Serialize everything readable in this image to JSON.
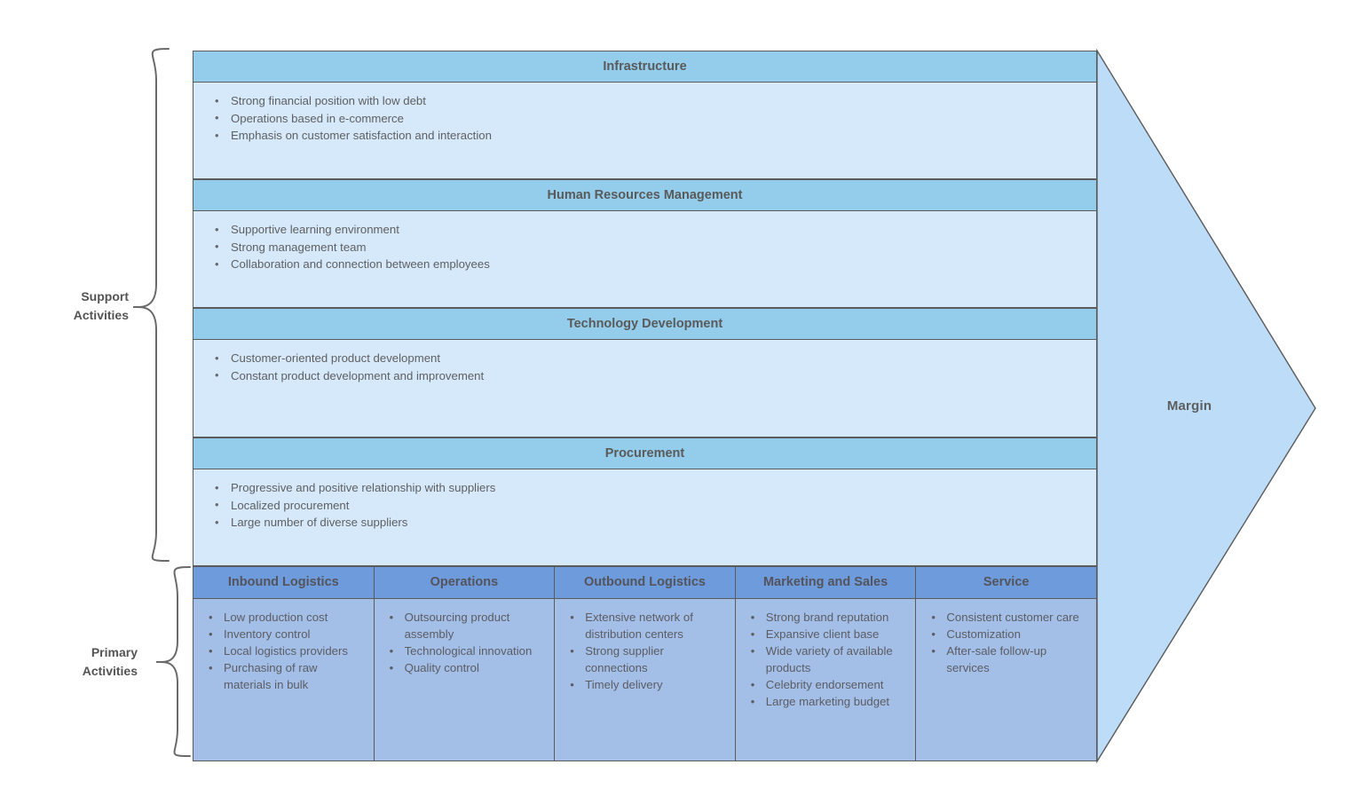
{
  "diagram": {
    "type": "value-chain",
    "margin": {
      "label": "Margin"
    },
    "side_labels": {
      "support": "Support\nActivities",
      "support_line1": "Support",
      "support_line2": "Activities",
      "primary_line1": "Primary",
      "primary_line2": "Activities"
    },
    "colors": {
      "support_header": "#93cdeb",
      "support_body": "#d6e9fb",
      "primary_header": "#6e9bdb",
      "primary_body": "#a3bfe8",
      "margin_arrow": "#bcdcf8",
      "outline": "#5b5b5b",
      "text": "#5a5a5a"
    },
    "support_activities": [
      {
        "title": "Infrastructure",
        "items": [
          "Strong financial position with low debt",
          "Operations based in e-commerce",
          "Emphasis on customer satisfaction and interaction"
        ]
      },
      {
        "title": "Human Resources Management",
        "items": [
          "Supportive learning environment",
          "Strong management team",
          "Collaboration and connection between employees"
        ]
      },
      {
        "title": "Technology Development",
        "items": [
          "Customer-oriented product development",
          "Constant product development and improvement"
        ]
      },
      {
        "title": "Procurement",
        "items": [
          "Progressive and positive relationship with suppliers",
          "Localized procurement",
          "Large number of diverse suppliers"
        ]
      }
    ],
    "primary_activities": [
      {
        "title": "Inbound Logistics",
        "items": [
          "Low production cost",
          "Inventory control",
          "Local logistics providers",
          "Purchasing of raw materials in bulk"
        ]
      },
      {
        "title": "Operations",
        "items": [
          "Outsourcing product assembly",
          "Technological innovation",
          "Quality control"
        ]
      },
      {
        "title": "Outbound Logistics",
        "items": [
          "Extensive network of distribution centers",
          "Strong supplier connections",
          "Timely delivery"
        ]
      },
      {
        "title": "Marketing and Sales",
        "items": [
          "Strong brand reputation",
          "Expansive client base",
          "Wide variety of available products",
          "Celebrity endorsement",
          "Large marketing budget"
        ]
      },
      {
        "title": "Service",
        "items": [
          "Consistent customer care",
          "Customization",
          "After-sale follow-up services"
        ]
      }
    ]
  }
}
